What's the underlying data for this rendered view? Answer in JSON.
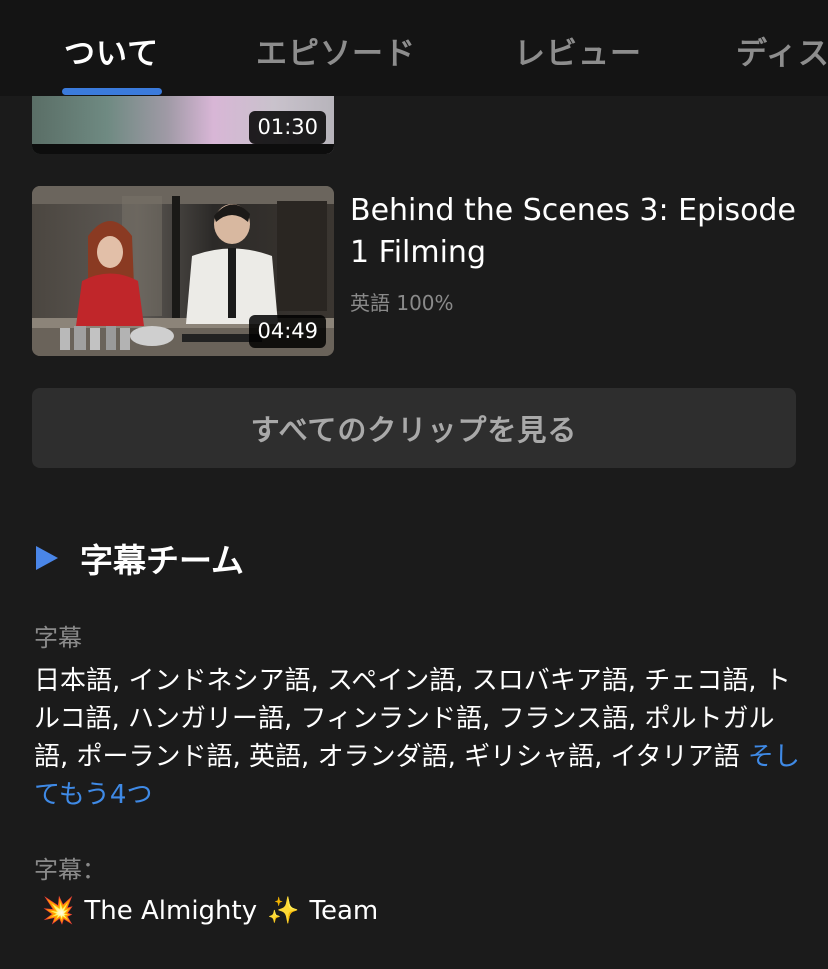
{
  "tabs": [
    {
      "label": "ついて",
      "active": true
    },
    {
      "label": "エピソード",
      "active": false
    },
    {
      "label": "レビュー",
      "active": false
    },
    {
      "label": "ディス",
      "active": false
    }
  ],
  "clips": [
    {
      "duration": "01:30"
    },
    {
      "title": "Behind the Scenes 3: Episode 1 Filming",
      "meta": "英語 100%",
      "duration": "04:49"
    }
  ],
  "all_clips_button": "すべてのクリップを見る",
  "subtitle_team": {
    "heading": "字幕チーム",
    "subtitles_label": "字幕",
    "languages": "日本語, インドネシア語, スペイン語, スロバキア語, チェコ語, トルコ語, ハンガリー語, フィンランド語, フランス語, ポルトガル語, ポーランド語, 英語, オランダ語, ギリシャ語, イタリア語",
    "more_link": "そしてもう4つ",
    "credit_label": "字幕：",
    "credit_prefix_emoji": "💥",
    "credit_text_1": "The Almighty",
    "credit_mid_emoji": "✨",
    "credit_text_2": "Team"
  },
  "colors": {
    "accent": "#3b7bdc",
    "link": "#3f8ae6",
    "background": "#1b1b1b"
  }
}
